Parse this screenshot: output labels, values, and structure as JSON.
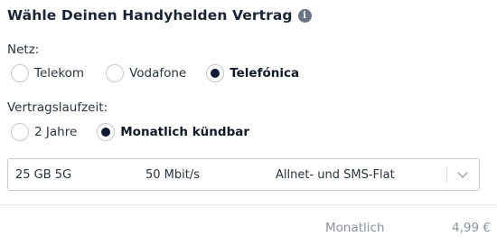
{
  "title": "Wähle Deinen Handyhelden Vertrag",
  "info_icon": "info-icon",
  "network": {
    "label": "Netz:",
    "options": [
      "Telekom",
      "Vodafone",
      "Telefónica"
    ],
    "selected": "Telefónica"
  },
  "term": {
    "label": "Vertragslaufzeit:",
    "options": [
      "2 Jahre",
      "Monatlich kündbar"
    ],
    "selected": "Monatlich kündbar"
  },
  "plan_select": {
    "data": "25 GB 5G",
    "speed": "50 Mbit/s",
    "flat": "Allnet- und SMS-Flat"
  },
  "footer": {
    "period": "Monatlich",
    "price": "4,99 €"
  }
}
